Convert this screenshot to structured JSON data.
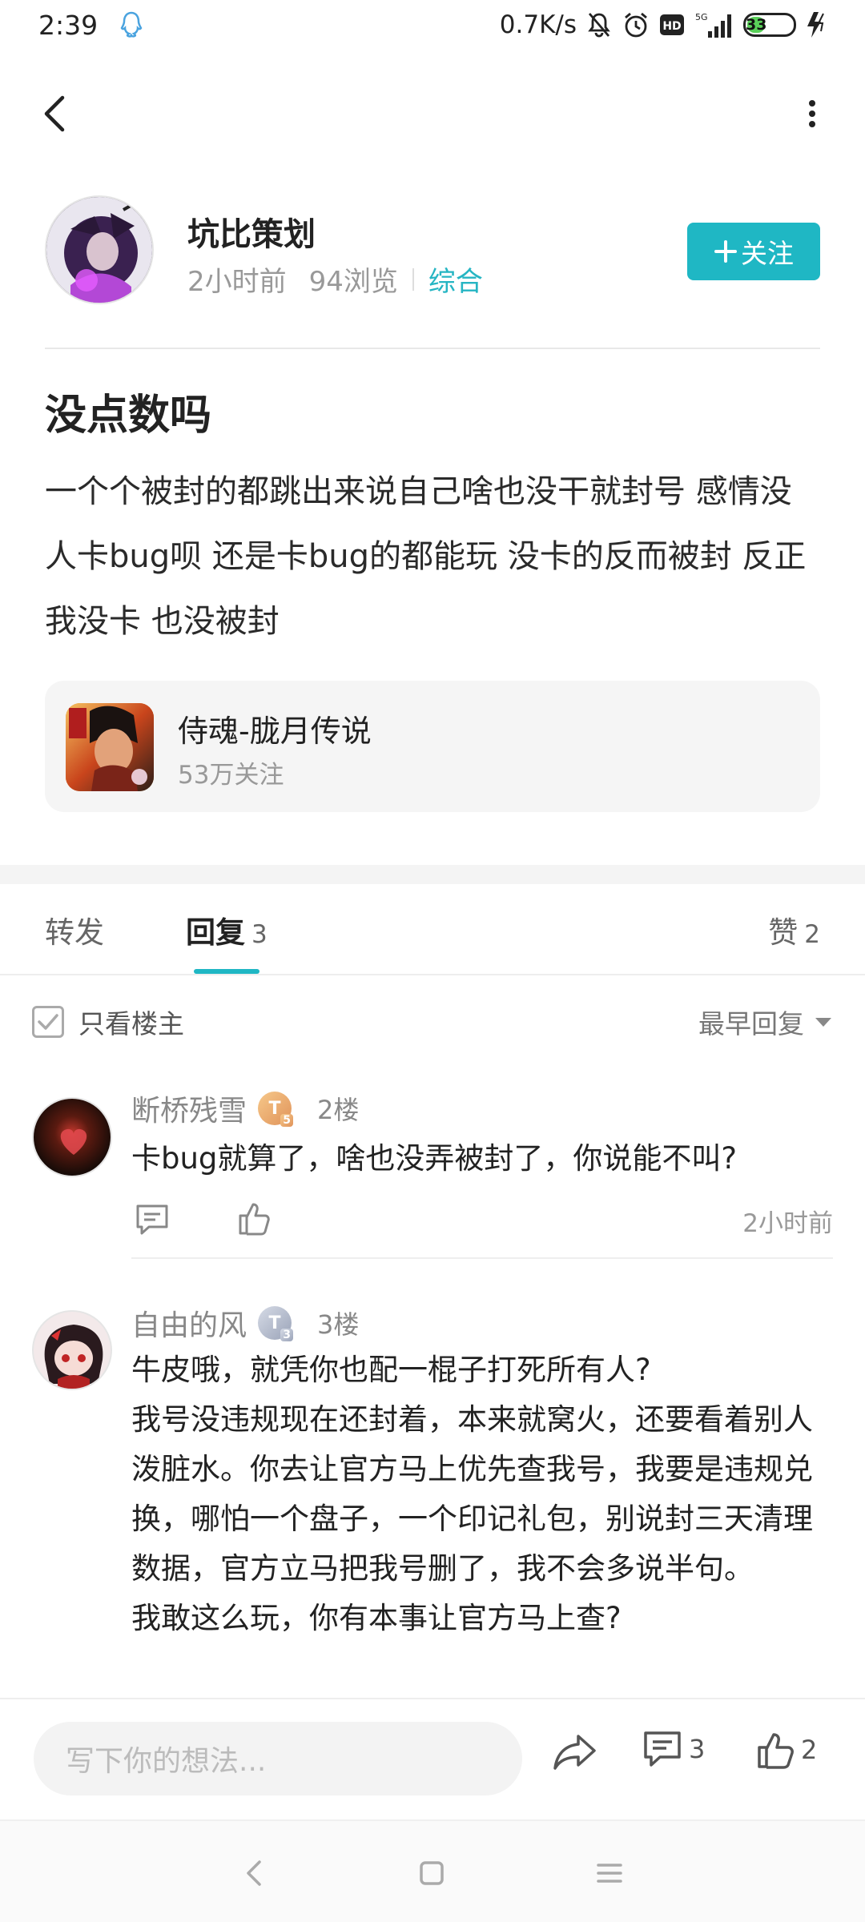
{
  "status_bar": {
    "time": "2:39",
    "net_speed": "0.7K/s",
    "network": "5G",
    "battery": "33"
  },
  "author": {
    "name": "坑比策划",
    "time_ago": "2小时前",
    "views": "94浏览",
    "category": "综合",
    "follow_label": "关注"
  },
  "post": {
    "title": "没点数吗",
    "body": "一个个被封的都跳出来说自己啥也没干就封号  感情没人卡bug呗 还是卡bug的都能玩 没卡的反而被封 反正我没卡 也没被封"
  },
  "game": {
    "name": "侍魂-胧月传说",
    "followers": "53万关注"
  },
  "tabs": {
    "forward": "转发",
    "reply": "回复",
    "reply_count": "3",
    "like": "赞",
    "like_count": "2"
  },
  "filter": {
    "only_op": "只看楼主",
    "sort": "最早回复"
  },
  "comments": [
    {
      "user": "断桥残雪",
      "level": "T",
      "level_sub": "5",
      "floor": "2楼",
      "text": "卡bug就算了，啥也没弄被封了，你说能不叫?",
      "time": "2小时前"
    },
    {
      "user": "自由的风",
      "level": "T",
      "level_sub": "3",
      "floor": "3楼",
      "text_lines": [
        "牛皮哦，就凭你也配一棍子打死所有人?",
        "我号没违规现在还封着，本来就窝火，还要看着别人泼脏水。你去让官方马上优先查我号，我要是违规兑换，哪怕一个盘子，一个印记礼包，别说封三天清理数据，官方立马把我号删了，我不会多说半句。",
        "我敢这么玩，你有本事让官方马上查?"
      ]
    }
  ],
  "bottom_bar": {
    "input_placeholder": "写下你的想法...",
    "comment_count": "3",
    "like_count": "2"
  },
  "colors": {
    "accent": "#1fb7c4",
    "text": "#222222",
    "muted": "#999999"
  }
}
